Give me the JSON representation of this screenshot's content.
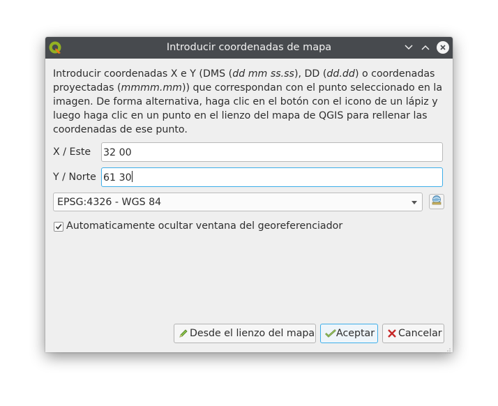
{
  "window": {
    "title": "Introducir coordenadas de mapa",
    "app_icon": "qgis-logo-icon",
    "controls": [
      "minimize-icon",
      "maximize-icon",
      "close-icon"
    ]
  },
  "description": {
    "p1": "Introducir coordenadas X e Y (DMS (",
    "i1": "dd mm ss.ss",
    "p2": "), DD (",
    "i2": "dd.dd",
    "p3": ") o coordenadas proyectadas (",
    "i3": "mmmm.mm",
    "p4": ")) que correspondan con el punto seleccionado en la imagen. De forma alternativa, haga clic en el botón con el icono de un lápiz y luego haga clic en un punto en el lienzo del mapa de QGIS para rellenar las coordenadas de ese punto."
  },
  "fields": {
    "x_label": "X / Este",
    "x_value": "32 00",
    "y_label": "Y / Norte",
    "y_value": "61 30"
  },
  "crs": {
    "selected": "EPSG:4326 - WGS 84",
    "button_icon": "crs-selector-icon"
  },
  "options": {
    "auto_hide_label": "Automaticamente ocultar ventana del georeferenciador",
    "auto_hide_checked": true
  },
  "buttons": {
    "from_canvas": "Desde el lienzo del mapa",
    "accept": "Aceptar",
    "cancel": "Cancelar"
  },
  "colors": {
    "titlebar": "#474a4e",
    "focus": "#3daee9",
    "dialog_bg": "#efefef"
  }
}
